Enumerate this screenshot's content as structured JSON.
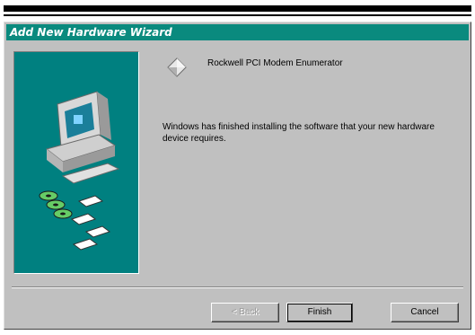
{
  "window": {
    "title": "Add New Hardware Wizard"
  },
  "content": {
    "device_name": "Rockwell PCI Modem Enumerator",
    "message": "Windows has finished installing the software that your new hardware device requires."
  },
  "buttons": {
    "back_label": "< Back",
    "finish_label": "Finish",
    "cancel_label": "Cancel"
  },
  "icons": {
    "illustration": "computer-with-installation-disks-illustration",
    "device": "hardware-device-icon"
  },
  "colors": {
    "title_bar": "#0a8a7e",
    "panel": "#008080",
    "dialog_face": "#c0c0c0"
  }
}
